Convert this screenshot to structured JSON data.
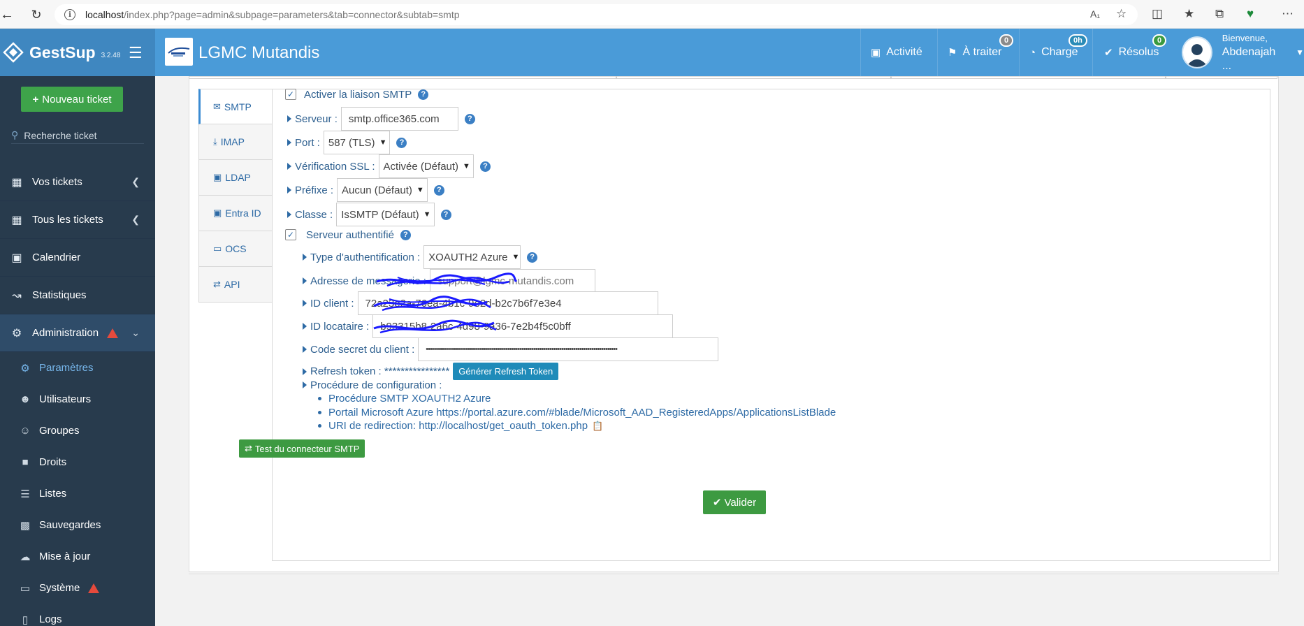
{
  "browser": {
    "url_host": "localhost",
    "url_path": "/index.php?page=admin&subpage=parameters&tab=connector&subtab=smtp"
  },
  "header": {
    "brand": "GestSup",
    "version": "3.2.48",
    "org_name": "LGMC Mutandis",
    "nav": {
      "activite": "Activité",
      "a_traiter": "À traiter",
      "a_traiter_badge": "0",
      "charge": "Charge",
      "charge_badge": "0h",
      "resolus": "Résolus",
      "resolus_badge": "0"
    },
    "welcome": "Bienvenue,",
    "username": "Abdenajah ..."
  },
  "sidebar": {
    "new_ticket": "Nouveau ticket",
    "search_placeholder": "Recherche ticket",
    "items": {
      "vos_tickets": "Vos tickets",
      "tous_tickets": "Tous les tickets",
      "calendrier": "Calendrier",
      "statistiques": "Statistiques",
      "administration": "Administration"
    },
    "sub": {
      "parametres": "Paramètres",
      "utilisateurs": "Utilisateurs",
      "groupes": "Groupes",
      "droits": "Droits",
      "listes": "Listes",
      "sauvegardes": "Sauvegardes",
      "mise_a_jour": "Mise à jour",
      "systeme": "Système",
      "logs": "Logs"
    }
  },
  "tabs": {
    "smtp": "SMTP",
    "imap": "IMAP",
    "ldap": "LDAP",
    "entra": "Entra ID",
    "ocs": "OCS",
    "api": "API"
  },
  "form": {
    "enable_smtp": "Activer la liaison SMTP",
    "server_label": "Serveur :",
    "server_value": "smtp.office365.com",
    "port_label": "Port :",
    "port_value": "587 (TLS)",
    "ssl_label": "Vérification SSL :",
    "ssl_value": "Activée (Défaut)",
    "prefix_label": "Préfixe :",
    "prefix_value": "Aucun (Défaut)",
    "class_label": "Classe :",
    "class_value": "IsSMTP (Défaut)",
    "auth_server": "Serveur authentifié",
    "auth_type_label": "Type d'authentification :",
    "auth_type_value": "XOAUTH2 Azure",
    "mail_label": "Adresse de messagerie :",
    "mail_value": "support@lgmc-mutandis.com",
    "client_id_label": "ID client :",
    "client_id_value": "72a23e2a-76ea-4b1c-9e2d-b2c7b6f7e3e4",
    "tenant_label": "ID locataire :",
    "tenant_value": "b93315b8-2a6c-4d98-9a36-7e2b4f5c0bff",
    "secret_label": "Code secret du client :",
    "secret_value": "••••••••••••••••••••••••••••••••••••••••••••••••••••••••••••••••••••••••••••••••••••••••••••••••",
    "refresh_label": "Refresh token : ****************",
    "refresh_btn": "Générer Refresh Token",
    "procedure_label": "Procédure de configuration :",
    "link1": "Procédure SMTP XOAUTH2 Azure",
    "link2": "Portail Microsoft Azure https://portal.azure.com/#blade/Microsoft_AAD_RegisteredApps/ApplicationsListBlade",
    "link3": "URI de redirection: http://localhost/get_oauth_token.php",
    "test_btn": "Test du connecteur SMTP",
    "submit": "Valider"
  },
  "colors": {
    "header": "#4a9bd8",
    "sidebar": "#283b4d",
    "success": "#3d9a41",
    "scribble": "#1a1aff"
  }
}
